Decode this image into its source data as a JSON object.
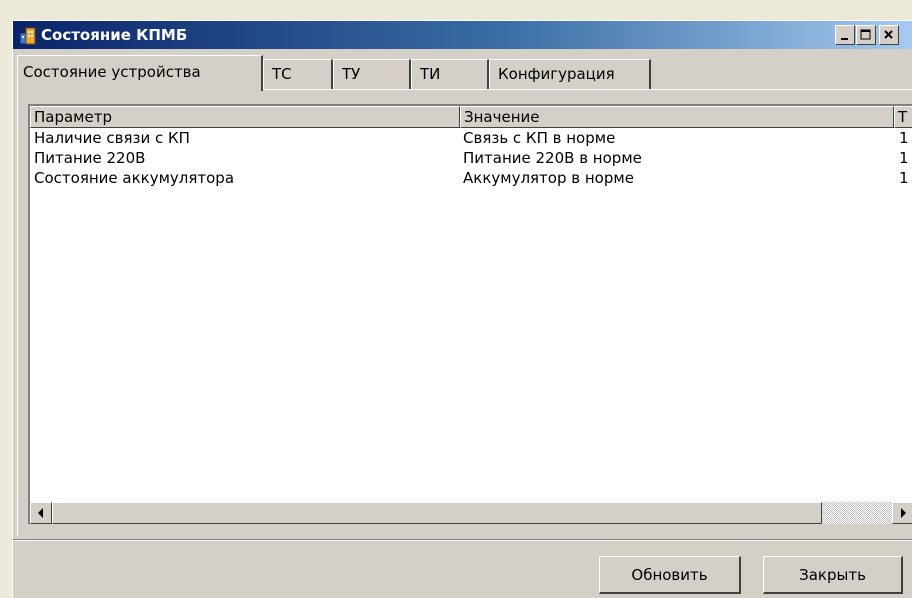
{
  "window": {
    "title": "Состояние КПМБ",
    "caption_buttons": {
      "minimize": "_",
      "maximize": "□",
      "close": "×"
    }
  },
  "tabs": [
    {
      "label": "Состояние устройства",
      "active": true
    },
    {
      "label": "ТС",
      "active": false
    },
    {
      "label": "ТУ",
      "active": false
    },
    {
      "label": "ТИ",
      "active": false
    },
    {
      "label": "Конфигурация",
      "active": false
    }
  ],
  "table": {
    "columns": [
      "Параметр",
      "Значение",
      "Т"
    ],
    "rows": [
      [
        "Наличие связи с КП",
        "Связь с КП в норме",
        "1"
      ],
      [
        "Питание 220В",
        "Питание 220В в норме",
        "1"
      ],
      [
        "Состояние аккумулятора",
        "Аккумулятор в норме",
        "1"
      ]
    ]
  },
  "scrollbar": {
    "left_arrow": "◄",
    "right_arrow": "►"
  },
  "buttons": {
    "refresh": "Обновить",
    "close": "Закрыть"
  },
  "colors": {
    "title_start": "#0a246a",
    "title_end": "#a6caf0",
    "face": "#d4d0c8"
  }
}
